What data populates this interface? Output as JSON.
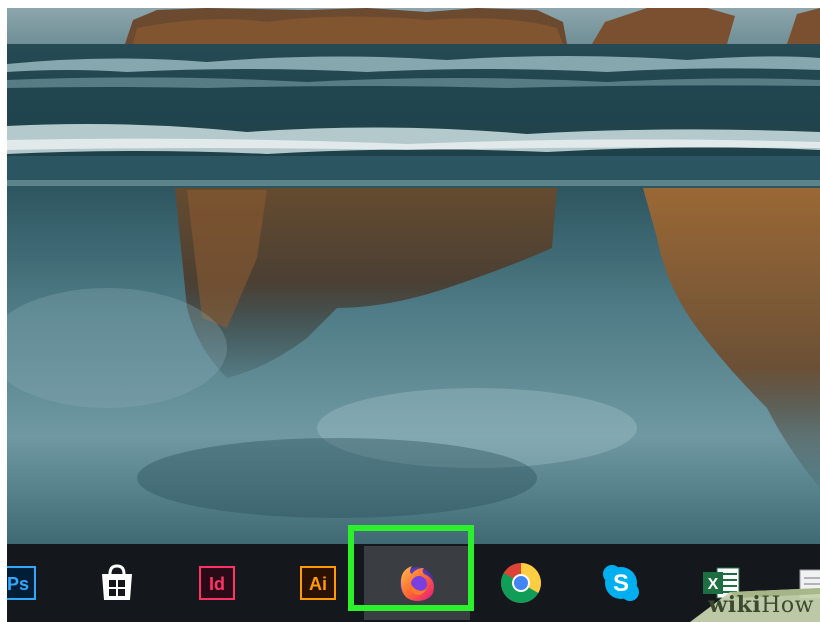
{
  "desktop": {
    "wallpaper": "beach-rocks-reflection"
  },
  "taskbar": {
    "apps": [
      {
        "name": "Adobe Photoshop",
        "icon": "photoshop-icon",
        "label": "Ps",
        "color": "#31a8ff"
      },
      {
        "name": "Microsoft Store",
        "icon": "store-bag-icon",
        "label": "",
        "color": "#ffffff"
      },
      {
        "name": "Adobe InDesign",
        "icon": "indesign-icon",
        "label": "Id",
        "color": "#ff3366"
      },
      {
        "name": "Adobe Illustrator",
        "icon": "illustrator-icon",
        "label": "Ai",
        "color": "#ff9a00"
      },
      {
        "name": "Firefox",
        "icon": "firefox-icon",
        "label": "",
        "highlighted": true,
        "highlight_color": "#2cf02c"
      },
      {
        "name": "Google Chrome",
        "icon": "chrome-icon",
        "label": ""
      },
      {
        "name": "Skype",
        "icon": "skype-icon",
        "label": "S",
        "color": "#00aff0"
      },
      {
        "name": "Microsoft Excel",
        "icon": "excel-icon",
        "label": "X",
        "color": "#1d6f42"
      },
      {
        "name": "Notepad",
        "icon": "notepad-icon",
        "label": ""
      }
    ]
  },
  "watermark": {
    "bold": "wiki",
    "thin": "How"
  }
}
